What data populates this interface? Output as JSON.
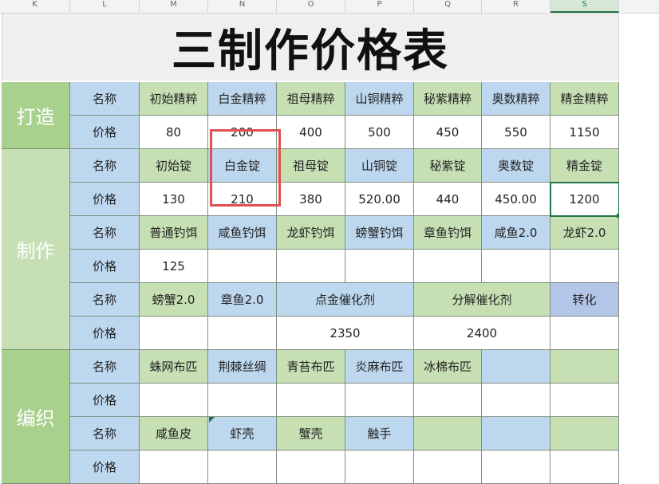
{
  "column_headers": [
    "K",
    "L",
    "M",
    "N",
    "O",
    "P",
    "Q",
    "R",
    "S"
  ],
  "title": "三制作价格表",
  "sections": [
    "打造",
    "制作",
    "编织"
  ],
  "label_name": "名称",
  "label_price": "价格",
  "rows": [
    {
      "kind": "name",
      "cells": [
        "初始精粹",
        "白金精粹",
        "祖母精粹",
        "山铜精粹",
        "秘紫精粹",
        "奥数精粹",
        "精金精粹"
      ]
    },
    {
      "kind": "price",
      "cells": [
        "80",
        "200",
        "400",
        "500",
        "450",
        "550",
        "1150"
      ]
    },
    {
      "kind": "name",
      "cells": [
        "初始锭",
        "白金锭",
        "祖母锭",
        "山铜锭",
        "秘紫锭",
        "奥数锭",
        "精金锭"
      ]
    },
    {
      "kind": "price",
      "cells": [
        "130",
        "210",
        "380",
        "520.00",
        "440",
        "450.00",
        "1200"
      ]
    },
    {
      "kind": "name",
      "cells": [
        "普通钓饵",
        "咸鱼钓饵",
        "龙虾钓饵",
        "螃蟹钓饵",
        "章鱼钓饵",
        "咸鱼2.0",
        "龙虾2.0"
      ]
    },
    {
      "kind": "price",
      "cells": [
        "125",
        "",
        "",
        "",
        "",
        "",
        ""
      ]
    },
    {
      "kind": "name",
      "cells": [
        "螃蟹2.0",
        "章鱼2.0",
        "点金催化剂",
        "分解催化剂",
        "转化"
      ]
    },
    {
      "kind": "price",
      "cells": [
        "",
        "",
        "2350",
        "2400",
        ""
      ]
    },
    {
      "kind": "name",
      "cells": [
        "蛛网布匹",
        "荆棘丝绸",
        "青苔布匹",
        "炎麻布匹",
        "冰棉布匹",
        "",
        ""
      ]
    },
    {
      "kind": "price",
      "cells": [
        "",
        "",
        "",
        "",
        "",
        "",
        ""
      ]
    },
    {
      "kind": "name",
      "cells": [
        "咸鱼皮",
        "虾壳",
        "蟹壳",
        "触手",
        "",
        "",
        ""
      ]
    },
    {
      "kind": "price",
      "cells": [
        "",
        "",
        "",
        "",
        "",
        "",
        ""
      ]
    }
  ]
}
